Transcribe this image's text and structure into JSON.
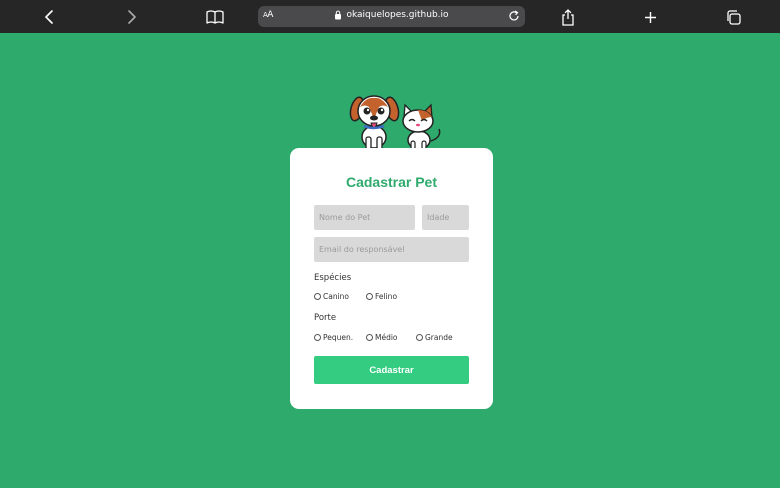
{
  "browser": {
    "url": "okaiquelopes.github.io",
    "reader_label_small": "A",
    "reader_label_large": "A",
    "icons": {
      "back": "chevron-left-icon",
      "forward": "chevron-right-icon",
      "bookmarks": "book-icon",
      "lock": "lock-icon",
      "reload": "reload-icon",
      "share": "share-icon",
      "new_tab": "plus-icon",
      "tabs": "tabs-icon"
    }
  },
  "form": {
    "title": "Cadastrar Pet",
    "name_placeholder": "Nome do Pet",
    "age_placeholder": "Idade",
    "email_placeholder": "Email do responsável",
    "species_label": "Espécies",
    "species_options": [
      "Canino",
      "Felino"
    ],
    "size_label": "Porte",
    "size_options": [
      "Pequen.",
      "Médio",
      "Grande"
    ],
    "submit_label": "Cadastrar"
  },
  "colors": {
    "background": "#2eaa6d",
    "title": "#2eaa6d",
    "button": "#33cc80",
    "input": "#d9d9d9",
    "toolbar": "#262626"
  }
}
